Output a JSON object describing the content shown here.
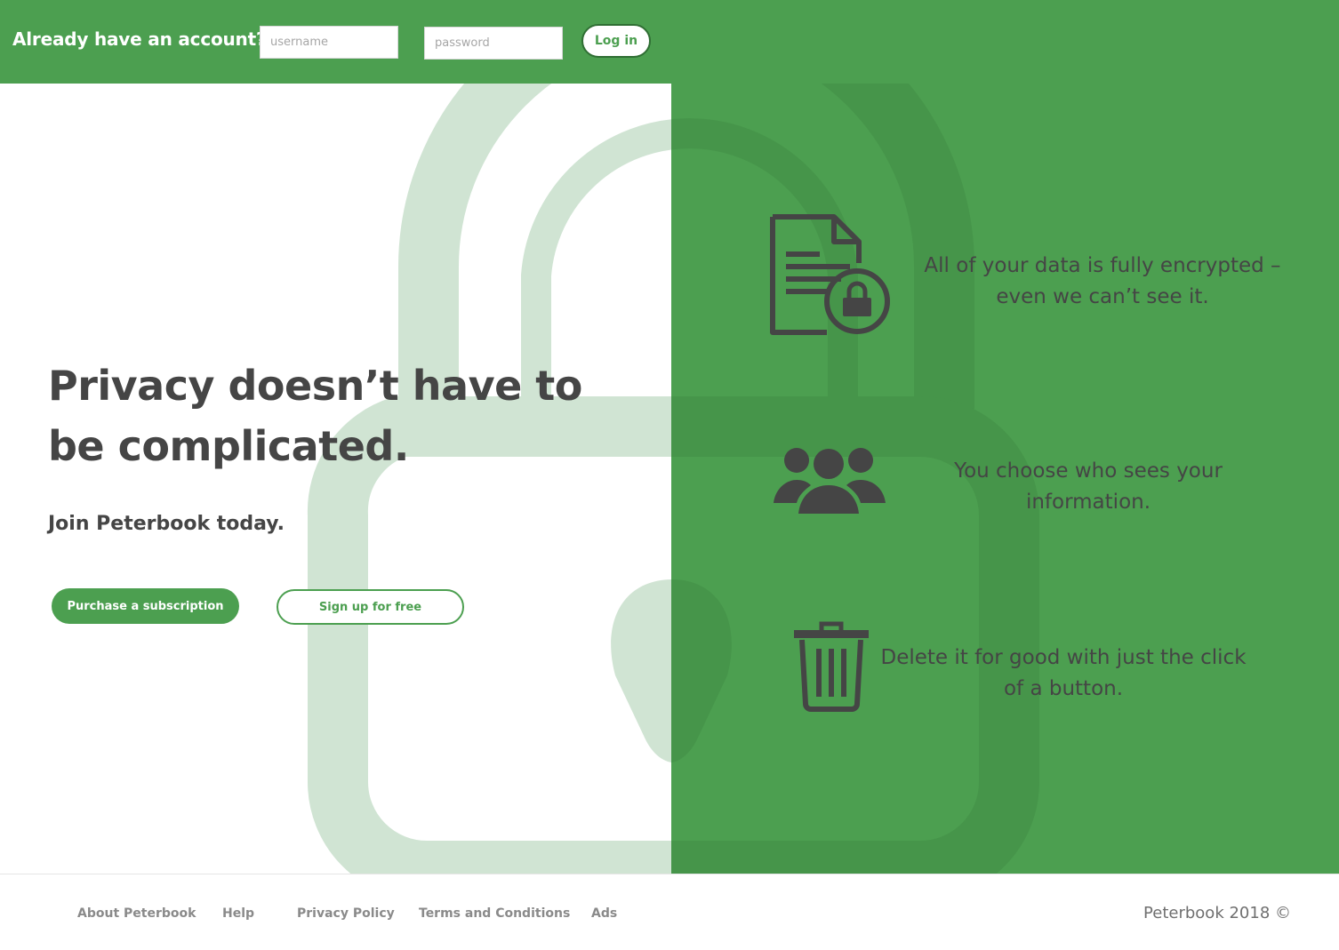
{
  "header": {
    "title": "Already have an account?",
    "username_placeholder": "username",
    "password_placeholder": "password",
    "login_label": "Log in"
  },
  "hero": {
    "title": "Privacy doesn’t have to be complicated.",
    "subtitle": "Join Peterbook today.",
    "primary_button": "Purchase a subscription",
    "secondary_button": "Sign up for free"
  },
  "features": [
    {
      "icon": "encrypted-document-icon",
      "text": "All of your data is fully encrypted – even we can’t see it."
    },
    {
      "icon": "people-group-icon",
      "text": "You choose who sees your information."
    },
    {
      "icon": "trash-can-icon",
      "text": "Delete it for good with just the click of a button."
    }
  ],
  "footer": {
    "links": [
      "About Peterbook",
      "Help",
      "Privacy Policy",
      "Terms and Conditions",
      "Ads"
    ],
    "copyright": "Peterbook 2018 ©"
  },
  "colors": {
    "brand_green": "#4c9f50",
    "text_dark": "#454545",
    "footer_text": "#8a8a8a"
  }
}
